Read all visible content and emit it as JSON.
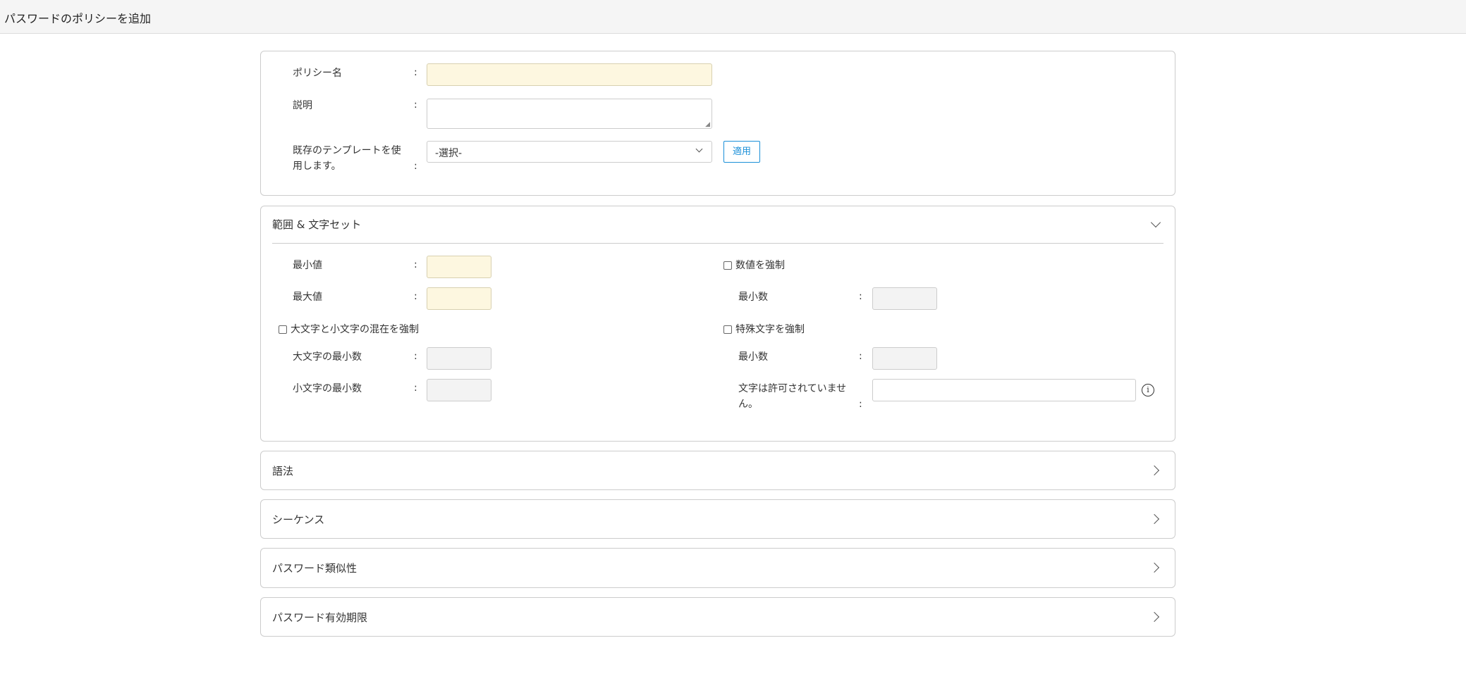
{
  "header": {
    "title": "パスワードのポリシーを追加"
  },
  "general": {
    "policy_name_label": "ポリシー名",
    "description_label": "説明",
    "template_label_line1": "既存のテンプレートを使",
    "template_label_line2": "用します。",
    "template_selected": "-選択-",
    "apply_button": "適用",
    "colon": ":"
  },
  "range": {
    "title": "範囲 & 文字セット",
    "min_label": "最小値",
    "max_label": "最大値",
    "mixed_case_label": "大文字と小文字の混在を強制",
    "upper_min_label": "大文字の最小数",
    "lower_min_label": "小文字の最小数",
    "numeric_label": "数値を強制",
    "numeric_min_label": "最小数",
    "special_label": "特殊文字を強制",
    "special_min_label": "最小数",
    "disallowed_label_line1": "文字は許可されていませ",
    "disallowed_label_line2": "ん。"
  },
  "sections": [
    "語法",
    "シーケンス",
    "パスワード類似性",
    "パスワード有効期限"
  ]
}
